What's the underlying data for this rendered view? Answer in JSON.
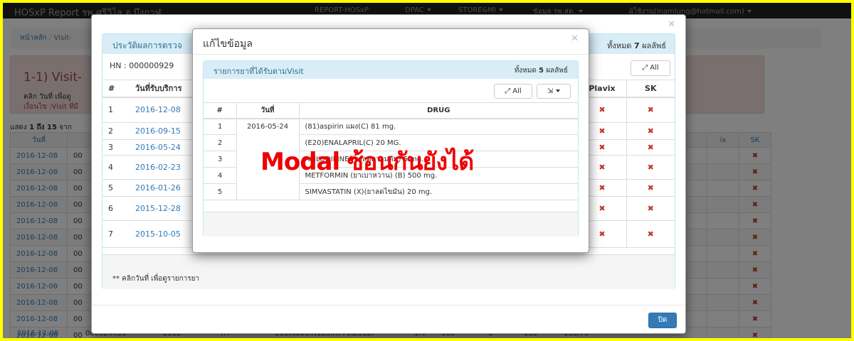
{
  "navbar": {
    "brand": "HOSxP Report รพ.ศรีวิไล จ.บึงกาฬ",
    "items": [
      "REPORT-HOSxP",
      "DPAC",
      "STORE&MI",
      "ข้อมูล รพ.สต."
    ],
    "user": "ผู้ใช้งาน(inamiung@hotmail.com)"
  },
  "background": {
    "breadcrumb_home": "หน้าหลัก",
    "breadcrumb_current": "Visit-",
    "alert_title": "1-1) Visit-",
    "alert_line1": "คลิก วันที่ เพื่อดู",
    "alert_line2": "เงื่อนไข :Visit ที่มี",
    "summary_prefix": "แสดง",
    "summary_range": "1 ถึง 15",
    "summary_suffix": "จาก",
    "header_date": "วันที่",
    "header_ix": "ix",
    "header_sk": "SK",
    "rows": [
      "2016-12-08",
      "2016-12-08",
      "2016-12-08",
      "2016-12-08",
      "2016-12-08",
      "2016-12-08",
      "2016-12-08",
      "2016-12-08",
      "2016-12-08",
      "2016-12-08",
      "2016-12-08",
      "2016-12-08"
    ],
    "row_prefix": "00",
    "last_row": [
      "2016-12-08",
      "000024436",
      "E112",
      "HT",
      "110IN083IN183IR779IZ012I",
      "1.4",
      "160",
      "1",
      "133",
      "130/70"
    ]
  },
  "modal1": {
    "heading": "ประวัติผลการตรวจ",
    "count_prefix": "ทั้งหมด",
    "count": "7",
    "count_suffix": "ผลลัพธ์",
    "hn_label": "HN : 000000929",
    "btn_all": "All",
    "col_num": "#",
    "col_date": "วันที่รับบริการ",
    "col_plavix": "Plavix",
    "col_sk": "SK",
    "rows": [
      {
        "num": "1",
        "date": "2016-12-08"
      },
      {
        "num": "2",
        "date": "2016-09-15"
      },
      {
        "num": "3",
        "date": "2016-05-24"
      },
      {
        "num": "4",
        "date": "2016-02-23"
      },
      {
        "num": "5",
        "date": "2016-01-26"
      },
      {
        "num": "6",
        "date": "2015-12-28"
      },
      {
        "num": "7",
        "date": "2015-10-05"
      }
    ],
    "x_mark": "✖",
    "footnote": "** คลิกวันที่ เพื่อดูรายการยา",
    "close_button": "ปิด"
  },
  "modal2": {
    "title": "แก้ไขข้อมูล",
    "heading": "รายการยาที่ได้รับตามVisit",
    "count_prefix": "ทั้งหมด",
    "count": "5",
    "count_suffix": "ผลลัพธ์",
    "btn_all": "All",
    "col_num": "#",
    "col_date": "วันที่",
    "col_drug": "DRUG",
    "date": "2016-05-24",
    "drugs": [
      {
        "num": "1",
        "drug": "(81)aspirin แผง(C) 81 mg."
      },
      {
        "num": "2",
        "drug": "(E20)ENALAPRIL(C) 20 MG."
      },
      {
        "num": "3",
        "drug": "AMLODIPINE (ยาลดความดัน) 5 mg."
      },
      {
        "num": "4",
        "drug": "METFORMIN (ยาเบาหวาน) (B) 500 mg."
      },
      {
        "num": "5",
        "drug": "SIMVASTATIN (X)(ยาลดไขมัน) 20 mg."
      }
    ]
  },
  "overlay_text": "Modal ซ้อนกันยังได้",
  "colors": {
    "frame": "#ffff00",
    "primary": "#337ab7",
    "panel_heading": "#d9edf7",
    "x_mark": "#c0392b",
    "overlay": "#ee0000"
  }
}
